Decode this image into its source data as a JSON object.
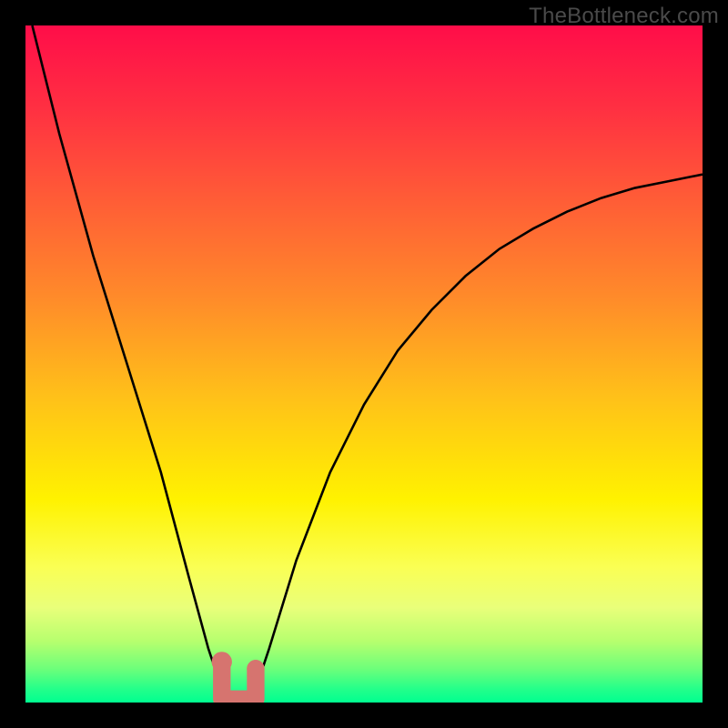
{
  "watermark": "TheBottleneck.com",
  "colors": {
    "frame": "#000000",
    "curve": "#000000",
    "marker": "#d6746f",
    "gradient_stops": [
      {
        "offset": 0.0,
        "color": "#ff0d49"
      },
      {
        "offset": 0.12,
        "color": "#ff2f42"
      },
      {
        "offset": 0.25,
        "color": "#ff5a37"
      },
      {
        "offset": 0.4,
        "color": "#ff8a2a"
      },
      {
        "offset": 0.55,
        "color": "#ffc119"
      },
      {
        "offset": 0.7,
        "color": "#fff200"
      },
      {
        "offset": 0.8,
        "color": "#faff54"
      },
      {
        "offset": 0.86,
        "color": "#e9ff7a"
      },
      {
        "offset": 0.91,
        "color": "#b6ff6e"
      },
      {
        "offset": 0.95,
        "color": "#6dff7a"
      },
      {
        "offset": 0.98,
        "color": "#24ff8a"
      },
      {
        "offset": 1.0,
        "color": "#00ff90"
      }
    ]
  },
  "chart_data": {
    "type": "line",
    "title": "",
    "xlabel": "",
    "ylabel": "",
    "xlim": [
      0,
      100
    ],
    "ylim": [
      0,
      100
    ],
    "legend": false,
    "grid": false,
    "series": [
      {
        "name": "bottleneck-curve",
        "x": [
          1,
          5,
          10,
          15,
          20,
          24,
          27,
          29,
          30,
          31,
          32,
          33,
          34,
          36,
          40,
          45,
          50,
          55,
          60,
          65,
          70,
          75,
          80,
          85,
          90,
          95,
          100
        ],
        "y": [
          100,
          84,
          66,
          50,
          34,
          19,
          8,
          2,
          0,
          0,
          0,
          0,
          2,
          8,
          21,
          34,
          44,
          52,
          58,
          63,
          67,
          70,
          72.5,
          74.5,
          76,
          77,
          78
        ]
      }
    ],
    "markers": [
      {
        "name": "left-marker-dot",
        "x": 29.0,
        "y": 6.0
      },
      {
        "name": "right-marker-dot",
        "x": 34.0,
        "y": 5.0
      }
    ],
    "flat_segment": {
      "x0": 29.5,
      "x1": 33.5,
      "y": 0.5
    }
  }
}
